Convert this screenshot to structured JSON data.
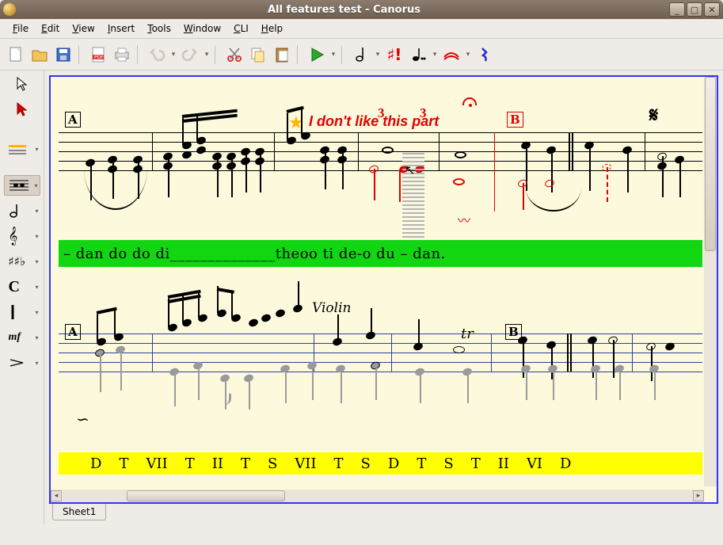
{
  "window": {
    "title": "All features test - Canorus"
  },
  "menu": {
    "file": "File",
    "edit": "Edit",
    "view": "View",
    "insert": "Insert",
    "tools": "Tools",
    "window": "Window",
    "cli": "CLI",
    "help": "Help"
  },
  "sheets": {
    "tab1": "Sheet1"
  },
  "score": {
    "mark_a_1": "A",
    "mark_b_1": "B",
    "mark_a_2": "A",
    "mark_b_2": "B",
    "annotation_text": "I don't like this part",
    "instrument_label": "Violin",
    "trill_label": "tr",
    "tuplet_3a": "3",
    "tuplet_3b": "3",
    "lyrics_green": "–   dan  do  do     di______________theoo  ti     de-o  du  –  dan.",
    "lyrics_yellow_items": [
      "D",
      "T",
      "VII",
      "T",
      "II",
      "T",
      "S",
      "VII",
      "T",
      "S",
      "D",
      "T",
      "S",
      "T",
      "II",
      "VI",
      "D"
    ]
  },
  "toolbar_icons": {
    "new": "new-document",
    "open": "open-document",
    "save": "save-document",
    "pdf": "export-pdf",
    "print": "print",
    "undo": "undo",
    "redo": "redo",
    "cut": "cut",
    "copy": "copy",
    "paste": "paste",
    "play": "play",
    "note_dur": "note-duration",
    "accidental": "accidental-sharp",
    "dot": "dotted-note",
    "tie": "tie-slur",
    "rest": "rest"
  },
  "sidebar_icons": {
    "select": "select-tool",
    "insert": "insert-note-tool",
    "clef": "clef-tool",
    "voice": "voice-tool",
    "note_half": "half-note-tool",
    "clef_g": "treble-clef-tool",
    "keysig": "key-signature-tool",
    "timesig": "time-signature-tool",
    "barline": "barline-tool",
    "dynamic": "dynamics-tool",
    "hairpin": "hairpin-tool"
  },
  "colors": {
    "accent_red": "#e00000",
    "score_bg": "#fcf9dc",
    "canvas_border": "#2b35ff",
    "lyrics_green": "#13d613",
    "lyrics_yellow": "#ffff00"
  }
}
